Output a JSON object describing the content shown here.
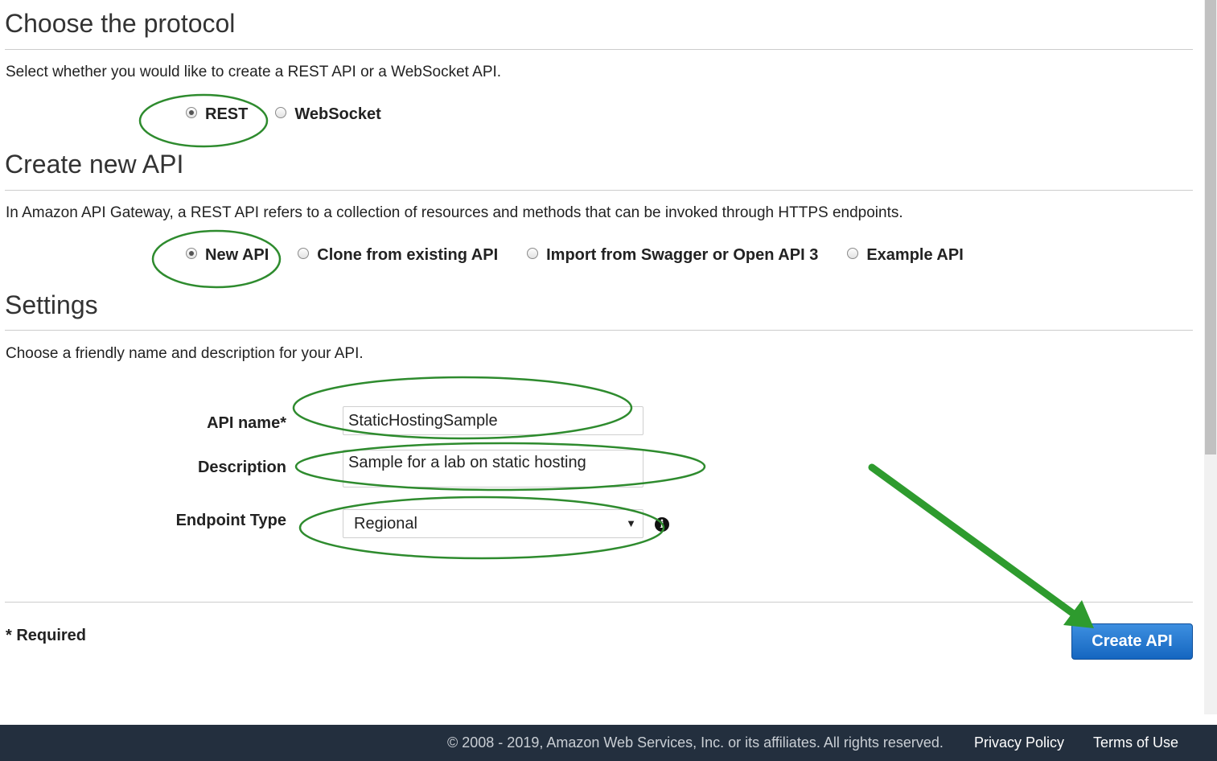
{
  "protocol": {
    "heading": "Choose the protocol",
    "description": "Select whether you would like to create a REST API or a WebSocket API.",
    "options": [
      {
        "label": "REST",
        "checked": true
      },
      {
        "label": "WebSocket",
        "checked": false
      }
    ]
  },
  "create_api": {
    "heading": "Create new API",
    "description": "In Amazon API Gateway, a REST API refers to a collection of resources and methods that can be invoked through HTTPS endpoints.",
    "options": [
      {
        "label": "New API",
        "checked": true
      },
      {
        "label": "Clone from existing API",
        "checked": false
      },
      {
        "label": "Import from Swagger or Open API 3",
        "checked": false
      },
      {
        "label": "Example API",
        "checked": false
      }
    ]
  },
  "settings": {
    "heading": "Settings",
    "description": "Choose a friendly name and description for your API.",
    "api_name_label": "API name*",
    "api_name_value": "StaticHostingSample",
    "description_label": "Description",
    "description_value": "Sample for a lab on static hosting",
    "endpoint_type_label": "Endpoint Type",
    "endpoint_type_value": "Regional"
  },
  "required_note": "* Required",
  "create_button_label": "Create API",
  "footer": {
    "copyright": "© 2008 - 2019, Amazon Web Services, Inc. or its affiliates. All rights reserved.",
    "privacy_link": "Privacy Policy",
    "terms_link": "Terms of Use"
  },
  "colors": {
    "annotation_green": "#2e8b2e",
    "button_blue": "#1b6fce",
    "footer_bg": "#232f3e"
  }
}
